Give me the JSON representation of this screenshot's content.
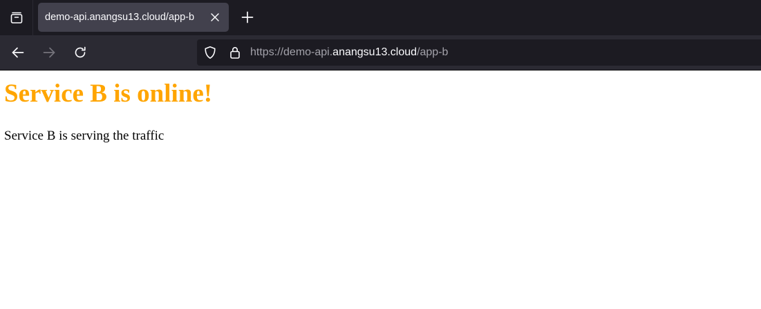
{
  "browser": {
    "tab": {
      "title": "demo-api.anangsu13.cloud/app-b",
      "close_icon": "close-icon"
    },
    "icons": {
      "tab_list": "tab-list-icon",
      "new_tab": "plus-icon",
      "back": "arrow-left-icon",
      "forward": "arrow-right-icon",
      "reload": "reload-icon",
      "tracking_protection": "shield-icon",
      "security": "lock-icon"
    },
    "url": {
      "prefix": "https://demo-api.",
      "domain": "anangsu13.cloud",
      "path": "/app-b"
    }
  },
  "page": {
    "heading": "Service B is online!",
    "heading_color": "#ffa500",
    "paragraph": "Service B is serving the traffic"
  },
  "colors": {
    "tabbar_bg": "#1c1b22",
    "navbar_bg": "#2b2a33",
    "active_tab_bg": "#42414d",
    "page_bg": "#ffffff"
  }
}
